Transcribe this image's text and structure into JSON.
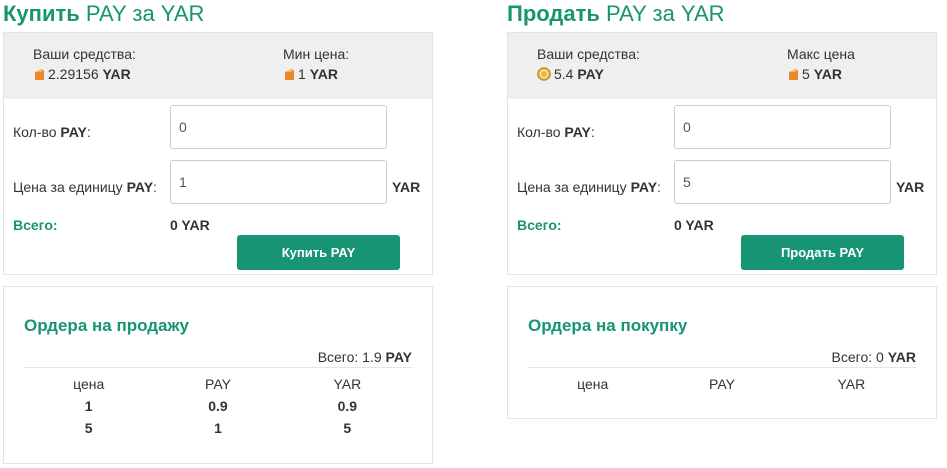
{
  "buy": {
    "title_bold": "Купить",
    "title_rest": "PAY за YAR",
    "funds_label": "Ваши средства:",
    "funds_amount": "2.29156",
    "funds_currency": "YAR",
    "funds_icon": "yar-coin-icon",
    "price_label": "Мин цена:",
    "price_amount": "1",
    "price_currency": "YAR",
    "price_icon": "yar-coin-icon",
    "qty_label_prefix": "Кол-во ",
    "qty_label_currency": "PAY",
    "qty_label_suffix": ":",
    "qty_value": "0",
    "unit_price_label_prefix": "Цена за единицу ",
    "unit_price_label_currency": "PAY",
    "unit_price_label_suffix": ":",
    "unit_price_value": "1",
    "unit_price_unit": "YAR",
    "total_label": "Всего:",
    "total_value": "0 YAR",
    "button_label": "Купить PAY"
  },
  "sell": {
    "title_bold": "Продать",
    "title_rest": "PAY за YAR",
    "funds_label": "Ваши средства:",
    "funds_amount": "5.4",
    "funds_currency": "PAY",
    "funds_icon": "pay-coin-icon",
    "price_label": "Макс цена",
    "price_amount": "5",
    "price_currency": "YAR",
    "price_icon": "yar-coin-icon",
    "qty_label_prefix": "Кол-во ",
    "qty_label_currency": "PAY",
    "qty_label_suffix": ":",
    "qty_value": "0",
    "unit_price_label_prefix": "Цена за единицу ",
    "unit_price_label_currency": "PAY",
    "unit_price_label_suffix": ":",
    "unit_price_value": "5",
    "unit_price_unit": "YAR",
    "total_label": "Всего:",
    "total_value": "0 YAR",
    "button_label": "Продать PAY"
  },
  "sell_orders": {
    "title": "Ордера на продажу",
    "total_label": "Всего: 1.9",
    "total_currency": "PAY",
    "columns": [
      "цена",
      "PAY",
      "YAR"
    ],
    "rows": [
      [
        "1",
        "0.9",
        "0.9"
      ],
      [
        "5",
        "1",
        "5"
      ]
    ]
  },
  "buy_orders": {
    "title": "Ордера на покупку",
    "total_label": "Всего: 0",
    "total_currency": "YAR",
    "columns": [
      "цена",
      "PAY",
      "YAR"
    ],
    "rows": []
  },
  "colors": {
    "accent": "#179473",
    "info_bg": "#efefef",
    "yar_coin": "#e8892b",
    "pay_coin": "#e0b33a"
  }
}
